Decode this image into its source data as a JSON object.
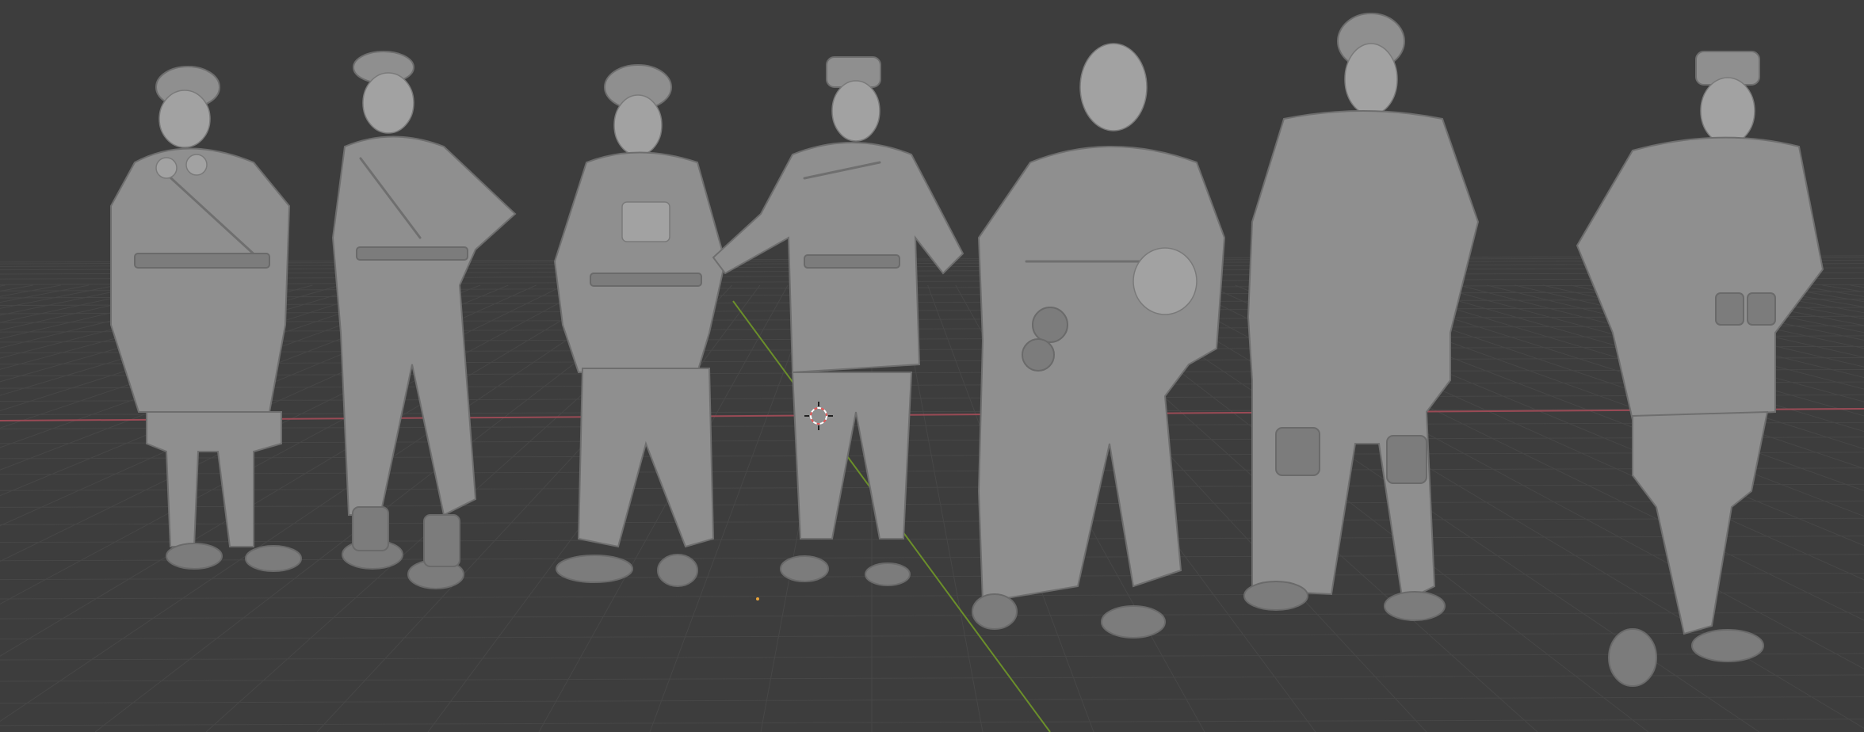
{
  "app": "3D viewport",
  "scene": {
    "background_color": "#3d3d3d",
    "grid_color": "#474747",
    "x_axis_color": "#9a4a55",
    "y_axis_color": "#6b8f2a",
    "model_color": "#8f8f8f",
    "figures": [
      {
        "name": "soldier-greatcoat-goggles"
      },
      {
        "name": "soldier-coverall-goggles"
      },
      {
        "name": "soldier-beret"
      },
      {
        "name": "soldier-side-cap"
      },
      {
        "name": "soldier-helmet-in-hand"
      },
      {
        "name": "soldier-flying-helmet"
      },
      {
        "name": "soldier-binoculars"
      }
    ]
  }
}
